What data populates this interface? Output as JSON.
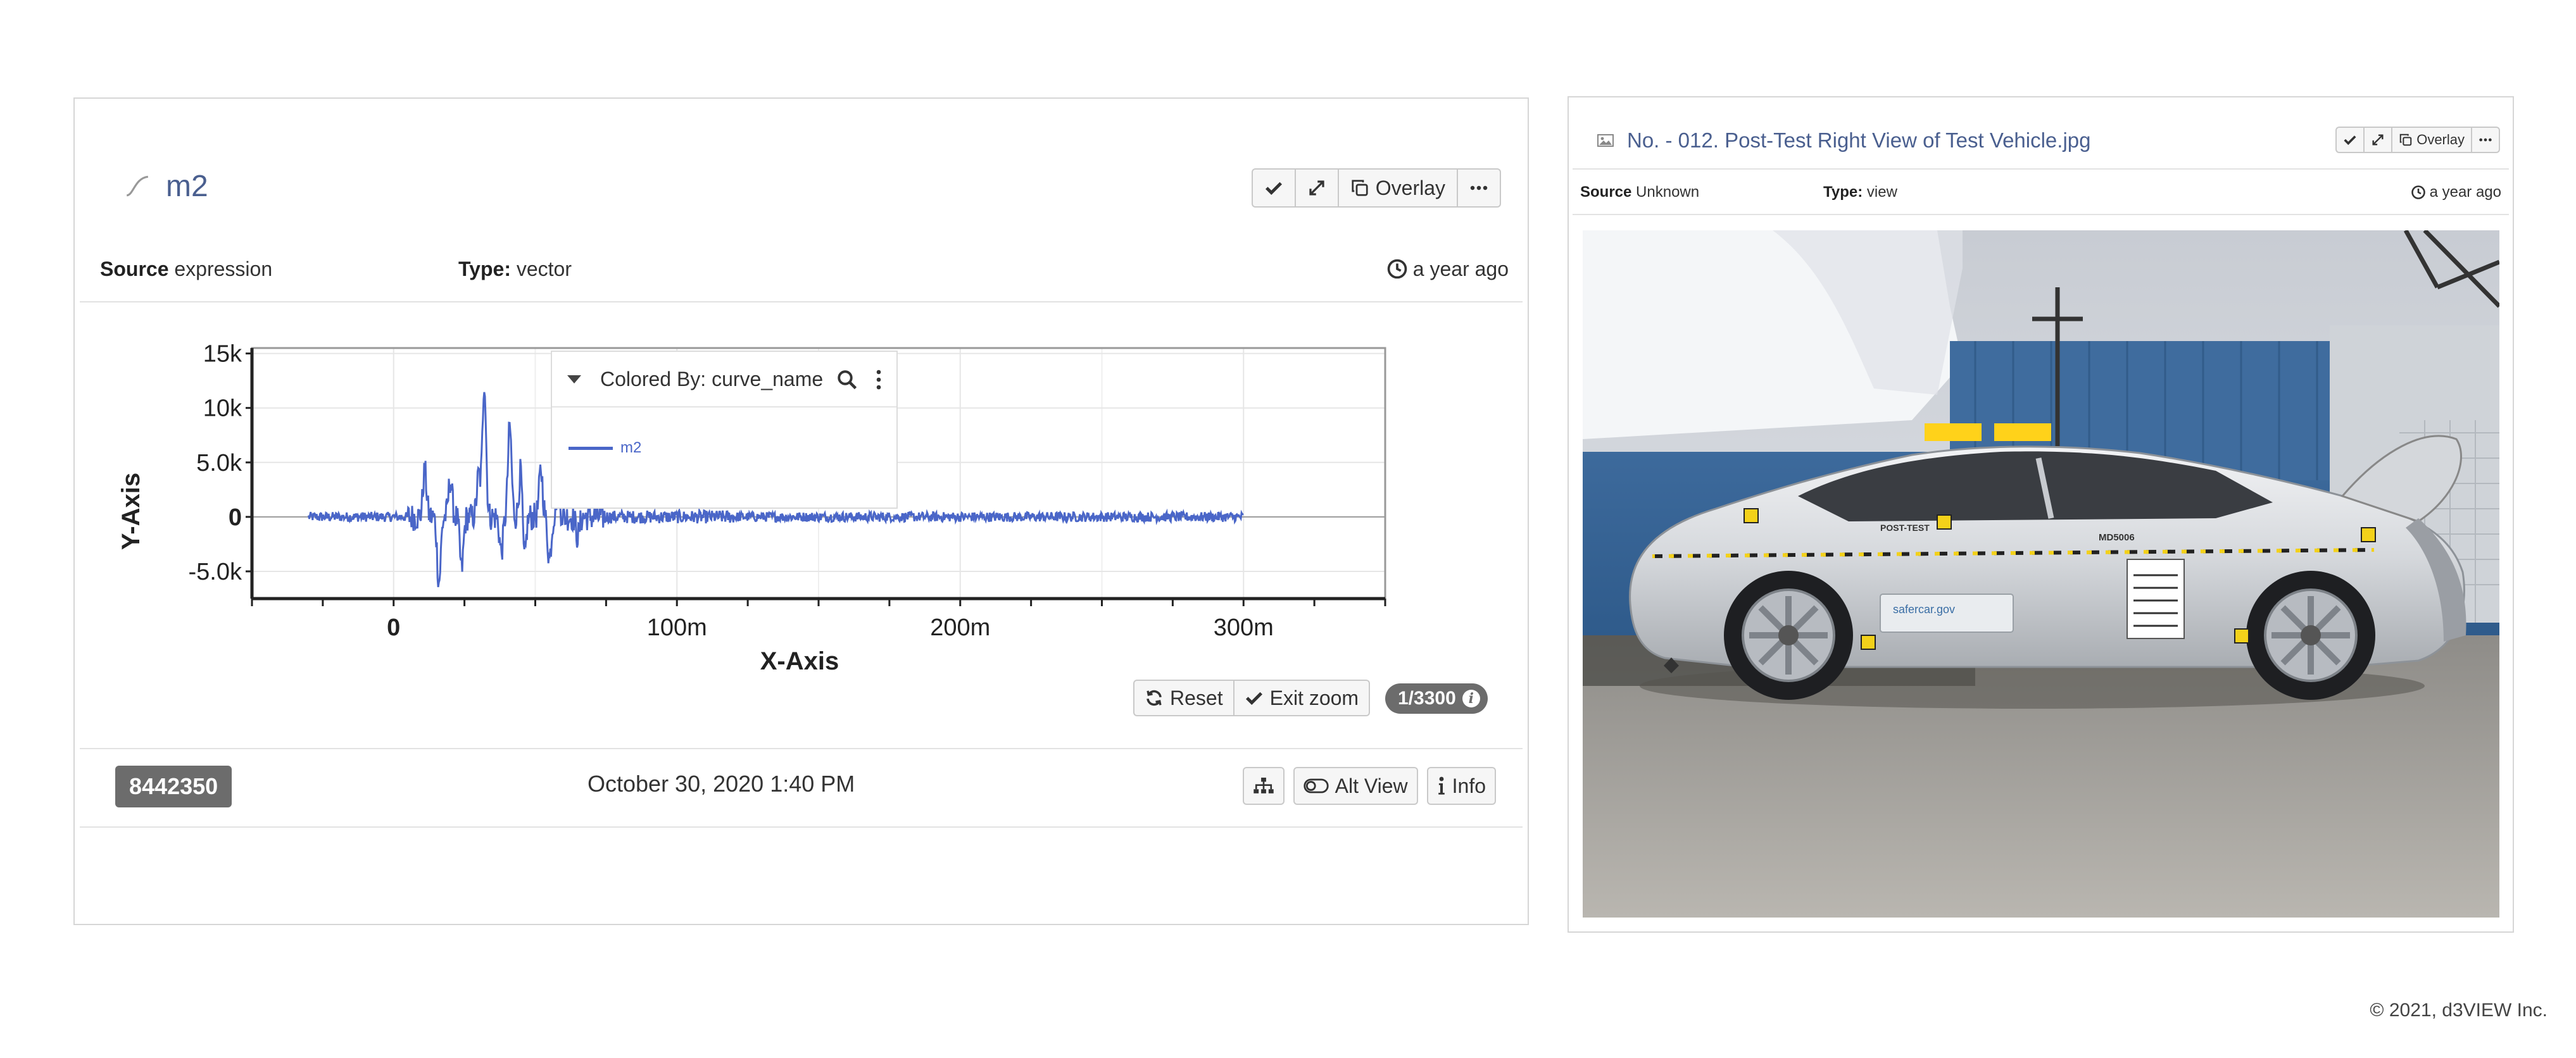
{
  "left_panel": {
    "title": "m2",
    "toolbar": {
      "overlay_label": "Overlay"
    },
    "meta": {
      "source_key": "Source",
      "source_value": "expression",
      "type_key": "Type:",
      "type_value": "vector",
      "time": "a year ago"
    },
    "legend": {
      "header": "Colored By: curve_name",
      "item": "m2"
    },
    "zoom_toolbar": {
      "reset_label": "Reset",
      "exit_zoom_label": "Exit zoom",
      "pager": "1/3300"
    },
    "footer": {
      "id": "8442350",
      "date": "October 30, 2020 1:40 PM",
      "alt_view_label": "Alt View",
      "info_label": "Info"
    }
  },
  "right_panel": {
    "title": "No. - 012. Post-Test Right View of Test Vehicle.jpg",
    "toolbar": {
      "overlay_label": "Overlay"
    },
    "meta": {
      "source_key": "Source",
      "source_value": "Unknown",
      "type_key": "Type:",
      "type_value": "view",
      "time": "a year ago"
    },
    "photo": {
      "tag_post_test": "POST-TEST",
      "tag_id": "MD5006",
      "door_logo": "safercar.gov"
    }
  },
  "chart_data": {
    "type": "line",
    "xlabel": "X-Axis",
    "ylabel": "Y-Axis",
    "xlim": [
      -0.05,
      0.35
    ],
    "ylim": [
      -7500,
      15500
    ],
    "x_ticks": [
      0,
      0.1,
      0.2,
      0.3
    ],
    "x_tick_labels": [
      "0",
      "100m",
      "200m",
      "300m"
    ],
    "y_ticks": [
      -5000,
      0,
      5000,
      10000,
      15000
    ],
    "y_tick_labels": [
      "-5.0k",
      "0",
      "5.0k",
      "10k",
      "15k"
    ],
    "grid": true,
    "series": [
      {
        "name": "m2",
        "color": "#4a66c8",
        "x_range": [
          -0.03,
          0.3
        ],
        "peaks": [
          {
            "x": 0.011,
            "y": 4200
          },
          {
            "x": 0.016,
            "y": -6000
          },
          {
            "x": 0.02,
            "y": 3400
          },
          {
            "x": 0.024,
            "y": -4800
          },
          {
            "x": 0.03,
            "y": 3800
          },
          {
            "x": 0.032,
            "y": 12500
          },
          {
            "x": 0.038,
            "y": -3200
          },
          {
            "x": 0.041,
            "y": 8200
          },
          {
            "x": 0.045,
            "y": 5200
          },
          {
            "x": 0.046,
            "y": -5000
          },
          {
            "x": 0.052,
            "y": 4300
          },
          {
            "x": 0.055,
            "y": -3800
          },
          {
            "x": 0.058,
            "y": 2400
          },
          {
            "x": 0.065,
            "y": -1800
          }
        ]
      }
    ]
  }
}
